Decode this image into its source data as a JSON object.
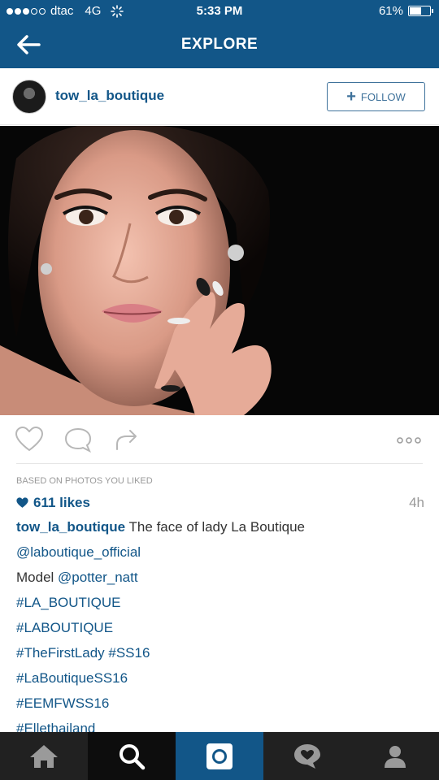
{
  "status_bar": {
    "carrier": "dtac",
    "network": "4G",
    "time": "5:33 PM",
    "battery": "61%",
    "battery_level": 0.61
  },
  "header": {
    "title": "EXPLORE"
  },
  "post": {
    "username": "tow_la_boutique",
    "follow_label": "FOLLOW",
    "based_on": "BASED ON PHOTOS YOU LIKED",
    "likes": "611 likes",
    "age": "4h",
    "caption": {
      "username": "tow_la_boutique",
      "text": "The face of lady La Boutique",
      "lines": [
        "@laboutique_official",
        "Model @potter_natt",
        "#LA_BOUTIQUE",
        "#LABOUTIQUE",
        "#TheFirstLady #SS16",
        "#LaBoutiqueSS16",
        "#EEMFWSS16",
        "#Ellethailand"
      ],
      "model_prefix": "Model ",
      "model_mention": "@potter_natt"
    }
  },
  "colors": {
    "brand": "#125688",
    "link": "#125688",
    "tabbar": "#212121"
  }
}
